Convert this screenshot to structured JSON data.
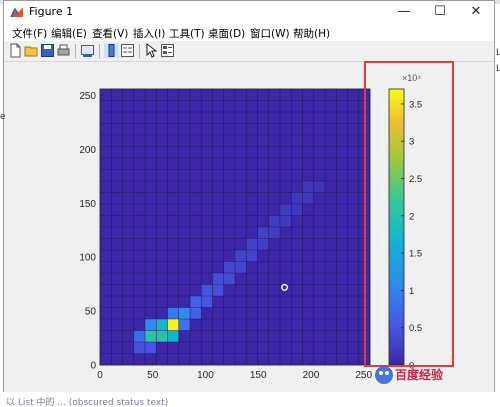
{
  "window": {
    "title": "Figure 1",
    "controls": {
      "minimize": "—",
      "maximize": "☐",
      "close": "✕"
    }
  },
  "menu": {
    "items": [
      "文件(F)",
      "编辑(E)",
      "查看(V)",
      "插入(I)",
      "工具(T)",
      "桌面(D)",
      "窗口(W)",
      "帮助(H)"
    ]
  },
  "toolbar": {
    "icons": [
      "new-figure-icon",
      "open-file-icon",
      "save-icon",
      "print-icon",
      "link-plot-icon",
      "insert-colorbar-icon",
      "insert-legend-icon",
      "pointer-icon",
      "property-inspector-icon"
    ]
  },
  "side_fragments": {
    "right_top": "Li",
    "right_mid": "La",
    "left_mid": "e"
  },
  "bottom_text": "以 List 中的 ... (obscured status text)",
  "watermark": {
    "text": "百度经验"
  },
  "colors": {
    "annotation_box": "#e53a3a",
    "heatmap_low": "#3e26a8",
    "heatmap_high": "#f9fb15"
  },
  "chart_data": {
    "type": "heatmap",
    "xlim": [
      0,
      256
    ],
    "ylim": [
      0,
      256
    ],
    "xticks": [
      0,
      50,
      100,
      150,
      200,
      250
    ],
    "yticks": [
      0,
      50,
      100,
      150,
      200,
      250
    ],
    "xtick_labels": [
      "0",
      "50",
      "100",
      "150",
      "200",
      "250"
    ],
    "ytick_labels": [
      "0",
      "50",
      "100",
      "150",
      "200",
      "250"
    ],
    "grid_bins": 24,
    "cells": [
      {
        "col": 6,
        "row": 3,
        "value": 36000
      },
      {
        "col": 5,
        "row": 3,
        "value": 9000
      },
      {
        "col": 6,
        "row": 2,
        "value": 9000
      },
      {
        "col": 5,
        "row": 2,
        "value": 12000
      },
      {
        "col": 4,
        "row": 2,
        "value": 13000
      },
      {
        "col": 4,
        "row": 3,
        "value": 4000
      },
      {
        "col": 7,
        "row": 4,
        "value": 4000
      },
      {
        "col": 6,
        "row": 4,
        "value": 3000
      },
      {
        "col": 7,
        "row": 3,
        "value": 2500
      },
      {
        "col": 8,
        "row": 4,
        "value": 1500
      },
      {
        "col": 8,
        "row": 5,
        "value": 1500
      },
      {
        "col": 3,
        "row": 2,
        "value": 2000
      },
      {
        "col": 4,
        "row": 1,
        "value": 1000
      },
      {
        "col": 3,
        "row": 1,
        "value": 900
      },
      {
        "col": 9,
        "row": 5,
        "value": 1000
      },
      {
        "col": 9,
        "row": 6,
        "value": 900
      },
      {
        "col": 10,
        "row": 6,
        "value": 800
      },
      {
        "col": 10,
        "row": 7,
        "value": 700
      },
      {
        "col": 11,
        "row": 7,
        "value": 600
      },
      {
        "col": 11,
        "row": 8,
        "value": 500
      },
      {
        "col": 12,
        "row": 8,
        "value": 500
      },
      {
        "col": 12,
        "row": 9,
        "value": 400
      },
      {
        "col": 13,
        "row": 9,
        "value": 400
      },
      {
        "col": 13,
        "row": 10,
        "value": 350
      },
      {
        "col": 14,
        "row": 10,
        "value": 300
      },
      {
        "col": 14,
        "row": 11,
        "value": 300
      },
      {
        "col": 15,
        "row": 11,
        "value": 250
      },
      {
        "col": 15,
        "row": 12,
        "value": 250
      },
      {
        "col": 16,
        "row": 12,
        "value": 200
      },
      {
        "col": 16,
        "row": 13,
        "value": 200
      },
      {
        "col": 17,
        "row": 13,
        "value": 150
      },
      {
        "col": 17,
        "row": 14,
        "value": 150
      },
      {
        "col": 18,
        "row": 14,
        "value": 120
      },
      {
        "col": 18,
        "row": 15,
        "value": 120
      },
      {
        "col": 19,
        "row": 15,
        "value": 100
      }
    ],
    "marker": {
      "x": 175,
      "y": 72
    },
    "colorbar": {
      "min": 0,
      "max": 37000,
      "ticks": [
        0,
        0.5,
        1,
        1.5,
        2,
        2.5,
        3,
        3.5
      ],
      "tick_labels": [
        "0",
        "0.5",
        "1",
        "1.5",
        "2",
        "2.5",
        "3",
        "3.5"
      ],
      "exponent_label": "×10⁴",
      "colormap": "parula"
    }
  }
}
